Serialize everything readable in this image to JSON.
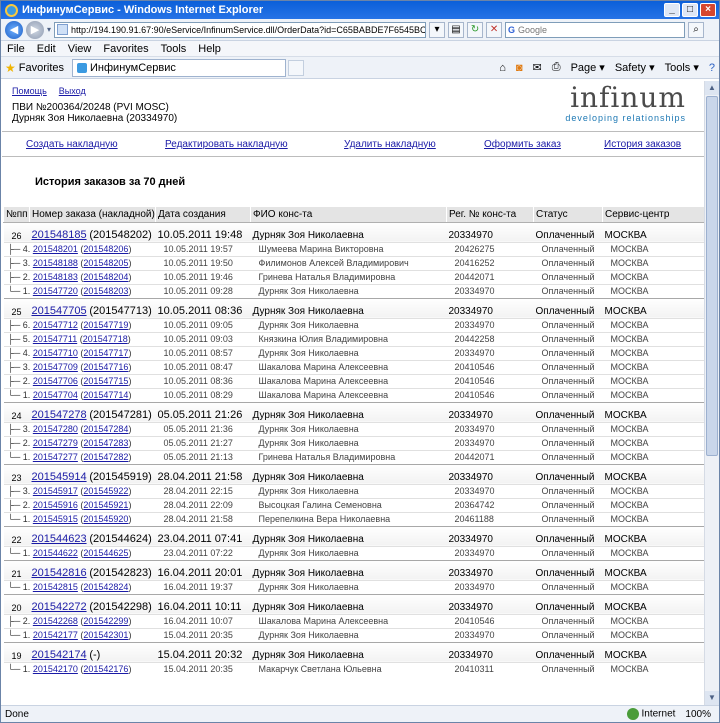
{
  "window": {
    "title": "ИнфинумСервис - Windows Internet Explorer"
  },
  "address_bar": {
    "url": "http://194.190.91.67:90/eService/InfinumService.dll/OrderData?id=C65BABDE7F6545BC93A3E858587EF",
    "search_placeholder": "Google"
  },
  "menu": [
    "File",
    "Edit",
    "View",
    "Favorites",
    "Tools",
    "Help"
  ],
  "favorites_bar": {
    "favorites_label": "Favorites",
    "tab_label": "ИнфинумСервис",
    "tools": [
      "Page ▾",
      "Safety ▾",
      "Tools ▾"
    ]
  },
  "header": {
    "help_link": "Помощь",
    "logout_link": "Выход",
    "order_line1": "ПВИ №200364/20248 (PVI MOSC)",
    "order_line2": "Дурняк Зоя Николаевна (20334970)",
    "logo_word": "infinum",
    "logo_slogan": "developing relationships"
  },
  "actions": [
    "Создать накладную",
    "Редактировать накладную",
    "Удалить накладную",
    "Оформить заказ",
    "История заказов"
  ],
  "history_title": "История заказов за 70 дней",
  "table": {
    "columns": [
      "№пп",
      "Номер заказа (накладной)",
      "Дата создания",
      "ФИО конс-та",
      "Рег. № конс-та",
      "Статус",
      "Сервис-центр"
    ],
    "groups": [
      {
        "num": "26",
        "order": "201548185",
        "ref": "(201548202)",
        "date": "10.05.2011 19:48",
        "name": "Дурняк Зоя Николаевна",
        "reg": "20334970",
        "status": "Оплаченный",
        "center": "МОСКВА",
        "subs": [
          {
            "n": "4.",
            "order": "201548201",
            "ref": "201548206",
            "date": "10.05.2011 19:57",
            "name": "Шумеева Марина Викторовна",
            "reg": "20426275",
            "status": "Оплаченный",
            "center": "МОСКВА"
          },
          {
            "n": "3.",
            "order": "201548188",
            "ref": "201548205",
            "date": "10.05.2011 19:50",
            "name": "Филимонов Алексей Владимирович",
            "reg": "20416252",
            "status": "Оплаченный",
            "center": "МОСКВА"
          },
          {
            "n": "2.",
            "order": "201548183",
            "ref": "201548204",
            "date": "10.05.2011 19:46",
            "name": "Гринева Наталья Владимировна",
            "reg": "20442071",
            "status": "Оплаченный",
            "center": "МОСКВА"
          },
          {
            "n": "1.",
            "order": "201547720",
            "ref": "201548203",
            "date": "10.05.2011 09:28",
            "name": "Дурняк Зоя Николаевна",
            "reg": "20334970",
            "status": "Оплаченный",
            "center": "МОСКВА"
          }
        ]
      },
      {
        "num": "25",
        "order": "201547705",
        "ref": "(201547713)",
        "date": "10.05.2011 08:36",
        "name": "Дурняк Зоя Николаевна",
        "reg": "20334970",
        "status": "Оплаченный",
        "center": "МОСКВА",
        "subs": [
          {
            "n": "6.",
            "order": "201547712",
            "ref": "201547719",
            "date": "10.05.2011 09:05",
            "name": "Дурняк Зоя Николаевна",
            "reg": "20334970",
            "status": "Оплаченный",
            "center": "МОСКВА"
          },
          {
            "n": "5.",
            "order": "201547711",
            "ref": "201547718",
            "date": "10.05.2011 09:03",
            "name": "Князкина Юлия Владимировна",
            "reg": "20442258",
            "status": "Оплаченный",
            "center": "МОСКВА"
          },
          {
            "n": "4.",
            "order": "201547710",
            "ref": "201547717",
            "date": "10.05.2011 08:57",
            "name": "Дурняк Зоя Николаевна",
            "reg": "20334970",
            "status": "Оплаченный",
            "center": "МОСКВА"
          },
          {
            "n": "3.",
            "order": "201547709",
            "ref": "201547716",
            "date": "10.05.2011 08:47",
            "name": "Шакалова Марина Алексеевна",
            "reg": "20410546",
            "status": "Оплаченный",
            "center": "МОСКВА"
          },
          {
            "n": "2.",
            "order": "201547706",
            "ref": "201547715",
            "date": "10.05.2011 08:36",
            "name": "Шакалова Марина Алексеевна",
            "reg": "20410546",
            "status": "Оплаченный",
            "center": "МОСКВА"
          },
          {
            "n": "1.",
            "order": "201547704",
            "ref": "201547714",
            "date": "10.05.2011 08:29",
            "name": "Шакалова Марина Алексеевна",
            "reg": "20410546",
            "status": "Оплаченный",
            "center": "МОСКВА"
          }
        ]
      },
      {
        "num": "24",
        "order": "201547278",
        "ref": "(201547281)",
        "date": "05.05.2011 21:26",
        "name": "Дурняк Зоя Николаевна",
        "reg": "20334970",
        "status": "Оплаченный",
        "center": "МОСКВА",
        "subs": [
          {
            "n": "3.",
            "order": "201547280",
            "ref": "201547284",
            "date": "05.05.2011 21:36",
            "name": "Дурняк Зоя Николаевна",
            "reg": "20334970",
            "status": "Оплаченный",
            "center": "МОСКВА"
          },
          {
            "n": "2.",
            "order": "201547279",
            "ref": "201547283",
            "date": "05.05.2011 21:27",
            "name": "Дурняк Зоя Николаевна",
            "reg": "20334970",
            "status": "Оплаченный",
            "center": "МОСКВА"
          },
          {
            "n": "1.",
            "order": "201547277",
            "ref": "201547282",
            "date": "05.05.2011 21:13",
            "name": "Гринева Наталья Владимировна",
            "reg": "20442071",
            "status": "Оплаченный",
            "center": "МОСКВА"
          }
        ]
      },
      {
        "num": "23",
        "order": "201545914",
        "ref": "(201545919)",
        "date": "28.04.2011 21:58",
        "name": "Дурняк Зоя Николаевна",
        "reg": "20334970",
        "status": "Оплаченный",
        "center": "МОСКВА",
        "subs": [
          {
            "n": "3.",
            "order": "201545917",
            "ref": "201545922",
            "date": "28.04.2011 22:15",
            "name": "Дурняк Зоя Николаевна",
            "reg": "20334970",
            "status": "Оплаченный",
            "center": "МОСКВА"
          },
          {
            "n": "2.",
            "order": "201545916",
            "ref": "201545921",
            "date": "28.04.2011 22:09",
            "name": "Высоцкая Галина Семеновна",
            "reg": "20364742",
            "status": "Оплаченный",
            "center": "МОСКВА"
          },
          {
            "n": "1.",
            "order": "201545915",
            "ref": "201545920",
            "date": "28.04.2011 21:58",
            "name": "Перепелкина Вера Николаевна",
            "reg": "20461188",
            "status": "Оплаченный",
            "center": "МОСКВА"
          }
        ]
      },
      {
        "num": "22",
        "order": "201544623",
        "ref": "(201544624)",
        "date": "23.04.2011 07:41",
        "name": "Дурняк Зоя Николаевна",
        "reg": "20334970",
        "status": "Оплаченный",
        "center": "МОСКВА",
        "subs": [
          {
            "n": "1.",
            "order": "201544622",
            "ref": "201544625",
            "date": "23.04.2011 07:22",
            "name": "Дурняк Зоя Николаевна",
            "reg": "20334970",
            "status": "Оплаченный",
            "center": "МОСКВА"
          }
        ]
      },
      {
        "num": "21",
        "order": "201542816",
        "ref": "(201542823)",
        "date": "16.04.2011 20:01",
        "name": "Дурняк Зоя Николаевна",
        "reg": "20334970",
        "status": "Оплаченный",
        "center": "МОСКВА",
        "subs": [
          {
            "n": "1.",
            "order": "201542815",
            "ref": "201542824",
            "date": "16.04.2011 19:37",
            "name": "Дурняк Зоя Николаевна",
            "reg": "20334970",
            "status": "Оплаченный",
            "center": "МОСКВА"
          }
        ]
      },
      {
        "num": "20",
        "order": "201542272",
        "ref": "(201542298)",
        "date": "16.04.2011 10:11",
        "name": "Дурняк Зоя Николаевна",
        "reg": "20334970",
        "status": "Оплаченный",
        "center": "МОСКВА",
        "subs": [
          {
            "n": "2.",
            "order": "201542268",
            "ref": "201542299",
            "date": "16.04.2011 10:07",
            "name": "Шакалова Марина Алексеевна",
            "reg": "20410546",
            "status": "Оплаченный",
            "center": "МОСКВА"
          },
          {
            "n": "1.",
            "order": "201542177",
            "ref": "201542301",
            "date": "15.04.2011 20:35",
            "name": "Дурняк Зоя Николаевна",
            "reg": "20334970",
            "status": "Оплаченный",
            "center": "МОСКВА"
          }
        ]
      },
      {
        "num": "19",
        "order": "201542174",
        "ref": "(-)",
        "date": "15.04.2011 20:32",
        "name": "Дурняк Зоя Николаевна",
        "reg": "20334970",
        "status": "Оплаченный",
        "center": "МОСКВА",
        "subs": [
          {
            "n": "1.",
            "order": "201542170",
            "ref": "201542176",
            "date": "15.04.2011 20:35",
            "name": "Макарчук Светлана Юльевна",
            "reg": "20410311",
            "status": "Оплаченный",
            "center": "МОСКВА"
          }
        ]
      }
    ]
  },
  "statusbar": {
    "left": "Done",
    "zone": "Internet",
    "zoom": "100%"
  }
}
